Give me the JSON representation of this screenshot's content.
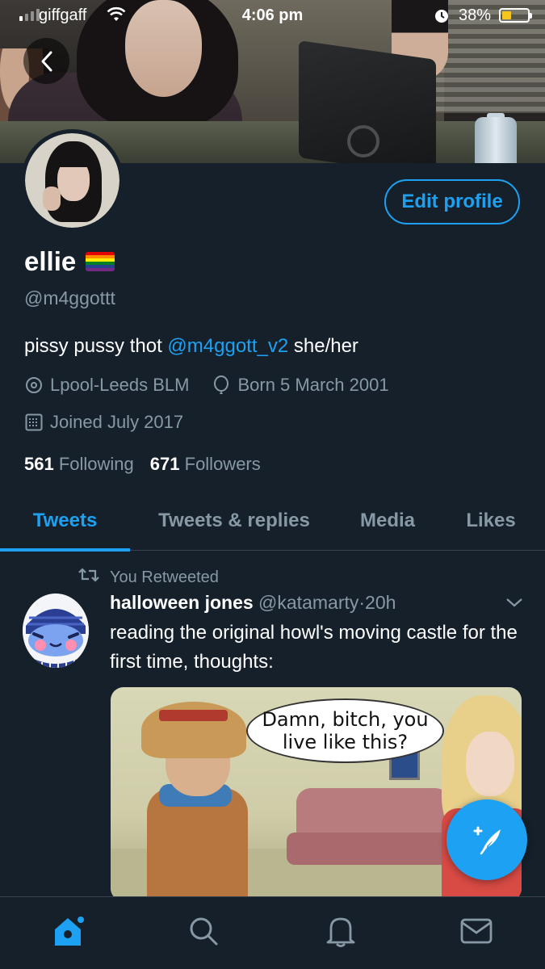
{
  "status_bar": {
    "carrier": "giffgaff",
    "time": "4:06 pm",
    "battery_percent": "38%",
    "battery_level": 0.38,
    "icons": [
      "signal-icon",
      "wifi-icon",
      "alarm-icon",
      "battery-icon"
    ]
  },
  "profile": {
    "display_name": "ellie",
    "name_emoji": "rainbow-flag",
    "handle": "@m4ggottt",
    "bio_text": "pissy pussy thot ",
    "bio_mention": "@m4ggott_v2",
    "bio_suffix": " she/her",
    "location": "Lpool-Leeds BLM",
    "birthday": "Born 5 March 2001",
    "joined": "Joined July 2017",
    "following_count": "561",
    "following_label": "Following",
    "followers_count": "671",
    "followers_label": "Followers",
    "edit_profile_label": "Edit profile"
  },
  "tabs": [
    {
      "label": "Tweets",
      "active": true
    },
    {
      "label": "Tweets & replies",
      "active": false
    },
    {
      "label": "Media",
      "active": false
    },
    {
      "label": "Likes",
      "active": false
    }
  ],
  "tweet": {
    "retweet_label": "You Retweeted",
    "author_name": "halloween jones",
    "author_handle": "@katamarty",
    "separator": "·",
    "time": "20h",
    "text": "reading the original howl's moving castle for the first time, thoughts:",
    "image_caption_line1": "Damn, bitch, you",
    "image_caption_line2": "live like this?"
  },
  "bottom_nav": [
    "home-icon",
    "search-icon",
    "notifications-icon",
    "messages-icon"
  ],
  "colors": {
    "background": "#15202b",
    "accent": "#1da1f2",
    "secondary_text": "#8899a6",
    "divider": "#38444d"
  }
}
